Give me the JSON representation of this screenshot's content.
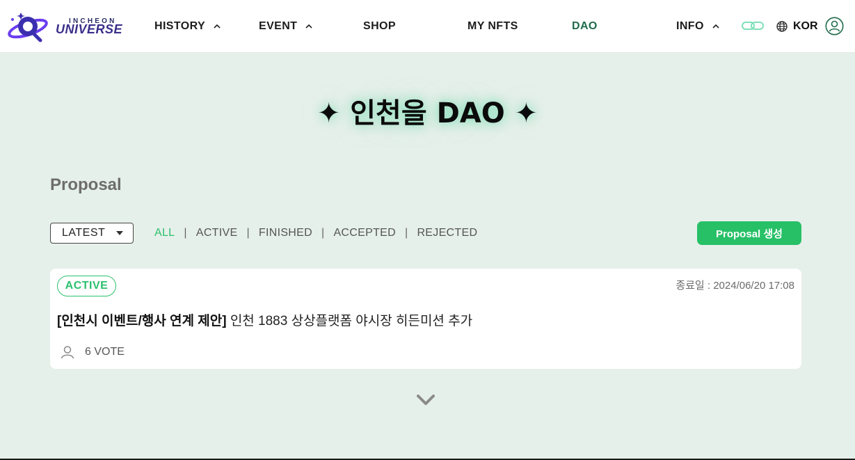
{
  "header": {
    "logo": {
      "small": "INCHEON",
      "big": "UNIVERSE"
    },
    "nav": [
      {
        "label": "HISTORY"
      },
      {
        "label": "EVENT"
      },
      {
        "label": "SHOP"
      },
      {
        "label": "MY NFTS"
      },
      {
        "label": "DAO"
      },
      {
        "label": "INFO"
      }
    ],
    "language": "KOR"
  },
  "page_title": "✦ 인천을 DAO ✦",
  "section_title": "Proposal",
  "toolbar": {
    "sort_value": "LATEST",
    "filters": [
      "ALL",
      "ACTIVE",
      "FINISHED",
      "ACCEPTED",
      "REJECTED"
    ],
    "filter_separator": "|",
    "create_label": "Proposal 생성"
  },
  "proposals": [
    {
      "status": "ACTIVE",
      "end_date": "종료일 : 2024/06/20 17:08",
      "category": "[인천시 이벤트/행사 연계 제안]",
      "title": "인천 1883 상상플랫폼 야시장 히든미션 추가",
      "votes": "6 VOTE"
    }
  ],
  "colors": {
    "accent": "#27c067",
    "active_nav": "#1f6b4a",
    "background": "#e6f0ea"
  },
  "icons": {
    "nav_caret": "chevron-up-icon",
    "link": "link-icon",
    "language": "globe-icon",
    "account": "user-circle-icon",
    "votes": "user-icon",
    "more": "chevron-down-icon"
  }
}
